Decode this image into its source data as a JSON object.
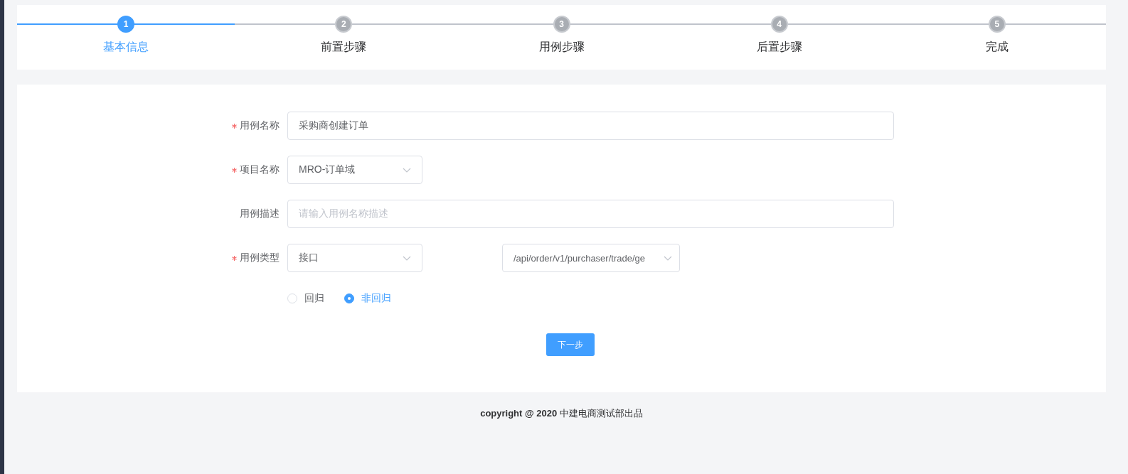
{
  "steps": [
    {
      "number": "1",
      "title": "基本信息",
      "selected": true
    },
    {
      "number": "2",
      "title": "前置步骤",
      "selected": false
    },
    {
      "number": "3",
      "title": "用例步骤",
      "selected": false
    },
    {
      "number": "4",
      "title": "后置步骤",
      "selected": false
    },
    {
      "number": "5",
      "title": "完成",
      "selected": false
    }
  ],
  "form": {
    "rows": [
      {
        "kind": "input",
        "label": "用例名称",
        "required": true,
        "value": "采购商创建订单"
      },
      {
        "kind": "select",
        "label": "项目名称",
        "required": true,
        "value": "MRO-订单域"
      },
      {
        "kind": "input",
        "label": "用例描述",
        "required": false,
        "placeholder": "请输入用例名称描述"
      },
      {
        "kind": "select-pair",
        "label": "用例类型",
        "required": true,
        "value": "接口",
        "second_value": "/api/order/v1/purchaser/trade/ge"
      }
    ],
    "radios": [
      {
        "label": "回归",
        "selected": false
      },
      {
        "label": "非回归",
        "selected": true
      }
    ],
    "submit": "下一步"
  },
  "footer": "**copyright @ 2020** 中建电商测试部出品"
}
